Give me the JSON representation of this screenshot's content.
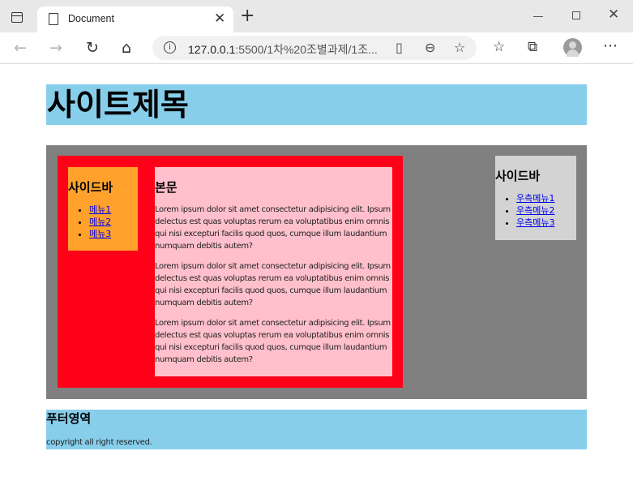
{
  "browser": {
    "tab_title": "Document",
    "url_host": "127.0.0.1",
    "url_rest": ":5500/1차%20조별과제/1조..."
  },
  "page": {
    "header_title": "사이트제목",
    "left_sidebar": {
      "title": "사이드바",
      "items": [
        "메뉴1",
        "메뉴2",
        "메뉴3"
      ]
    },
    "main": {
      "title": "본문",
      "paragraphs": [
        "Lorem ipsum dolor sit amet consectetur adipisicing elit. Ipsum delectus est quas voluptas rerum ea voluptatibus enim omnis qui nisi excepturi facilis quod quos, cumque illum laudantium numquam debitis autem?",
        "Lorem ipsum dolor sit amet consectetur adipisicing elit. Ipsum delectus est quas voluptas rerum ea voluptatibus enim omnis qui nisi excepturi facilis quod quos, cumque illum laudantium numquam debitis autem?",
        "Lorem ipsum dolor sit amet consectetur adipisicing elit. Ipsum delectus est quas voluptas rerum ea voluptatibus enim omnis qui nisi excepturi facilis quod quos, cumque illum laudantium numquam debitis autem?"
      ]
    },
    "right_sidebar": {
      "title": "사이드바",
      "items": [
        "우측메뉴1",
        "우측메뉴2",
        "우측메뉴3"
      ]
    },
    "footer": {
      "title": "푸터영역",
      "copyright": "copyright all right reserved."
    }
  },
  "colors": {
    "header_bg": "#87ceeb",
    "container_bg": "#808080",
    "wrap_bg": "#ff0019",
    "left_sidebar_bg": "#ffa12b",
    "main_bg": "#ffc0cb",
    "right_sidebar_bg": "#d3d3d3",
    "footer_bg": "#87ceeb"
  }
}
